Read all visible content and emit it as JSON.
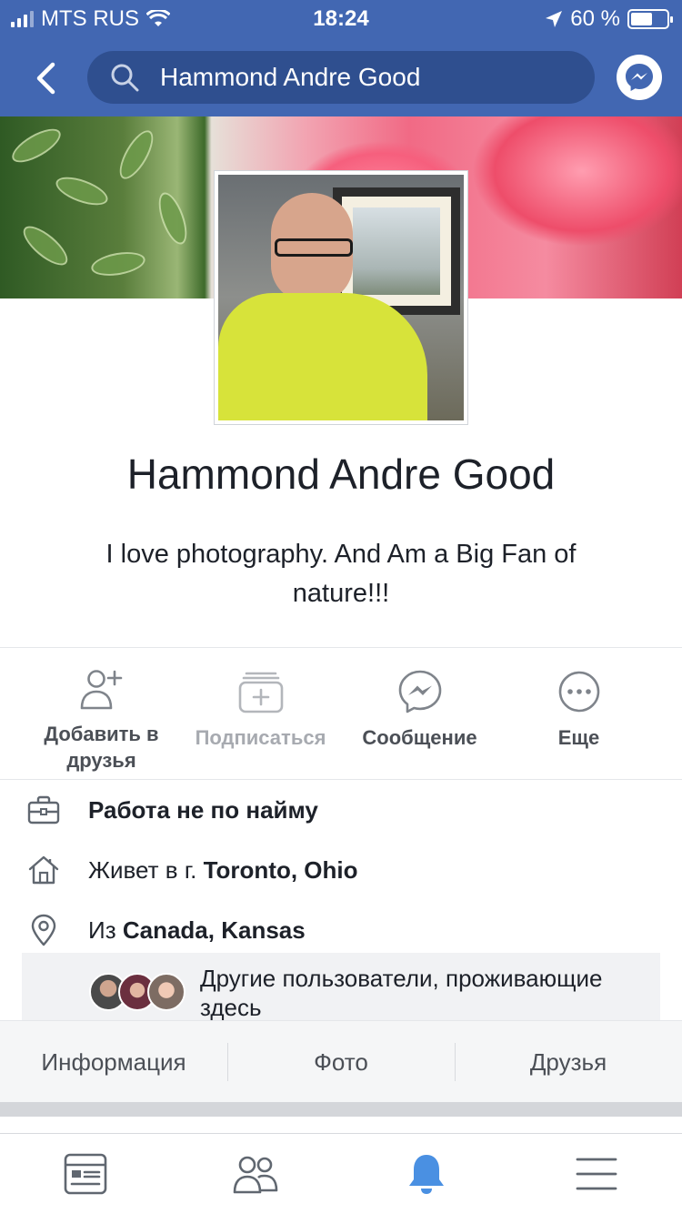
{
  "status_bar": {
    "carrier": "MTS RUS",
    "time": "18:24",
    "battery": "60 %",
    "battery_level": 0.6
  },
  "nav": {
    "search_text": "Hammond Andre Good"
  },
  "profile": {
    "name": "Hammond Andre Good",
    "bio": "I love photography. And Am a Big Fan of nature!!!"
  },
  "actions": [
    {
      "label": "Добавить в друзья",
      "icon": "add-friend-icon"
    },
    {
      "label": "Подписаться",
      "icon": "follow-icon",
      "disabled": true
    },
    {
      "label": "Сообщение",
      "icon": "messenger-icon"
    },
    {
      "label": "Еще",
      "icon": "more-icon"
    }
  ],
  "info": {
    "work": "Работа не по найму",
    "lives_prefix": "Живет в г.",
    "lives_place": "Toronto, Ohio",
    "from_prefix": "Из",
    "from_place": "Canada, Kansas",
    "others": "Другие пользователи, проживающие здесь"
  },
  "tabs": [
    "Информация",
    "Фото",
    "Друзья"
  ],
  "bottom_nav": [
    "news-feed-icon",
    "friends-icon",
    "notifications-icon",
    "menu-icon"
  ],
  "colors": {
    "brand": "#4267b2",
    "active": "#4a90e2"
  }
}
